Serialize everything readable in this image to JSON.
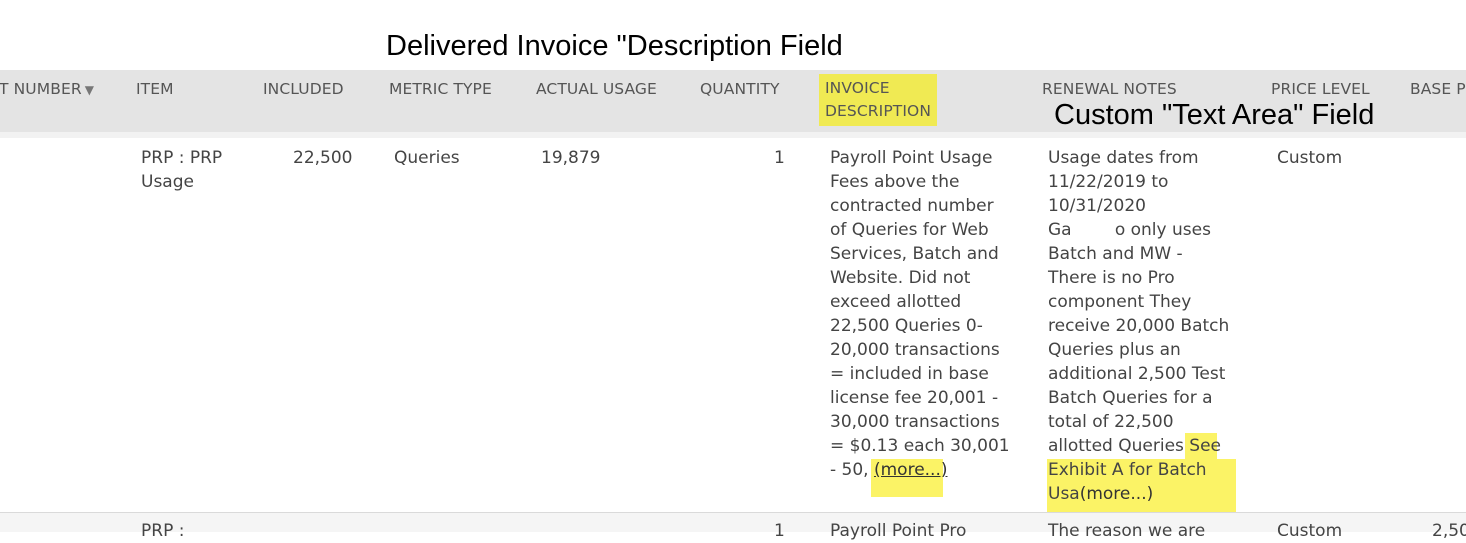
{
  "annotations": {
    "delivered": "Delivered Invoice \"Description Field",
    "custom": "Custom \"Text Area\"  Field"
  },
  "columns": {
    "number": "T NUMBER",
    "item": "ITEM",
    "included": "INCLUDED",
    "metric_type": "METRIC TYPE",
    "actual_usage": "ACTUAL USAGE",
    "quantity": "QUANTITY",
    "invoice_desc_1": "INVOICE",
    "invoice_desc_2": "DESCRIPTION",
    "renewal_notes": "RENEWAL NOTES",
    "price_level": "PRICE LEVEL",
    "base_price": "BASE PR"
  },
  "row1": {
    "item": "PRP : PRP\nUsage",
    "included": "22,500",
    "metric_type": "Queries",
    "actual_usage": "19,879",
    "quantity": "1",
    "invoice_description": "Payroll Point Usage\nFees above the\ncontracted number\nof Queries for Web\nServices, Batch and\nWebsite. Did not\nexceed allotted\n22,500 Queries 0-\n20,000 transactions\n= included in base\nlicense fee 20,001 -\n30,000 transactions\n= $0.13 each 30,001\n- 50, ",
    "invoice_more": "(more...)",
    "renewal_notes": "Usage dates from\n11/22/2019 to\n10/31/2020\nGa        o only uses\nBatch and MW -\nThere is no Pro\ncomponent They\nreceive 20,000 Batch\nQueries plus an\nadditional 2,500 Test\nBatch Queries for a\ntotal of 22,500\nallotted Queries ",
    "renewal_see": "See",
    "renewal_tail": "Exhibit A for Batch\nUsa",
    "renewal_more": "(more...)",
    "price_level": "Custom"
  },
  "row2": {
    "item": "PRP :",
    "quantity": "1",
    "invoice_description": "Payroll Point Pro",
    "renewal_notes": "The reason we are",
    "price_level": "Custom",
    "base_price": "2,50"
  }
}
